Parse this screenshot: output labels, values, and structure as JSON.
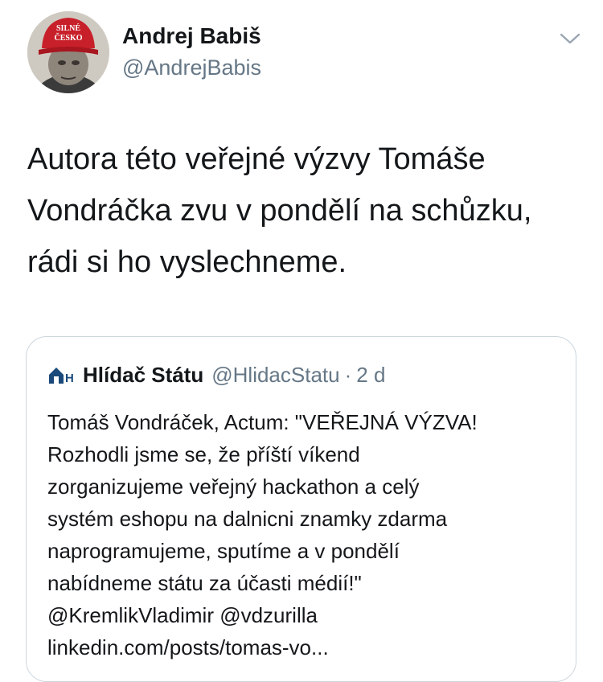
{
  "tweet": {
    "author_name": "Andrej Babiš",
    "author_handle": "@AndrejBabis",
    "avatar_cap_text_line1": "SILNÉ",
    "avatar_cap_text_line2": "ČESKO",
    "text_lines": [
      "Autora této veřejné výzvy Tomáše",
      "Vondráčka zvu v pondělí na schůzku,",
      "rádi si ho vyslechneme."
    ],
    "menu_icon": "chevron-down-icon"
  },
  "quoted": {
    "author_name": "Hlídač Státu",
    "author_handle": "@HlidacStatu",
    "separator": "·",
    "time": "2 d",
    "logo_icon": "hlidac-statu-logo-icon",
    "text_lines": [
      "Tomáš Vondráček, Actum:  \"VEŘEJNÁ VÝZVA!",
      "Rozhodli jsme se, že příští víkend",
      "zorganizujeme veřejný hackathon a celý",
      "systém eshopu na dalnicni znamky zdarma",
      "naprogramujeme, sputíme a v pondělí",
      "nabídneme státu za účasti médií!\"",
      "@KremlikVladimir @vdzurilla",
      "linkedin.com/posts/tomas-vo..."
    ]
  },
  "colors": {
    "text_primary": "#14171a",
    "text_secondary": "#657786",
    "border": "#ccd6dd",
    "cap_red": "#c8202a",
    "logo_blue": "#1b4a7a"
  }
}
